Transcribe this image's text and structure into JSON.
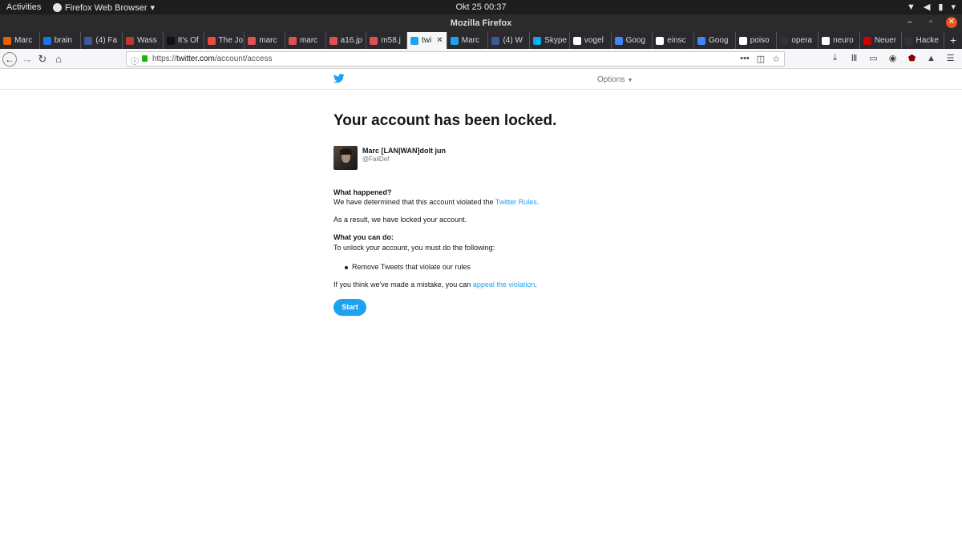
{
  "os_bar": {
    "activities": "Activities",
    "app_menu": "Firefox Web Browser",
    "clock": "Okt 25  00:37"
  },
  "window": {
    "title": "Mozilla Firefox"
  },
  "tabs": [
    {
      "label": "Marc",
      "favicon_color": "#e66000"
    },
    {
      "label": "brain",
      "favicon_color": "#1a73e8"
    },
    {
      "label": "(4) Fa",
      "favicon_color": "#3b5998"
    },
    {
      "label": "Wass",
      "favicon_color": "#c0392b"
    },
    {
      "label": "It's Of",
      "favicon_color": "#111111"
    },
    {
      "label": "The Jo",
      "favicon_color": "#e74c3c"
    },
    {
      "label": "marc",
      "favicon_color": "#e05050"
    },
    {
      "label": "marc",
      "favicon_color": "#e05050"
    },
    {
      "label": "a16.jp",
      "favicon_color": "#e05050"
    },
    {
      "label": "m58.j",
      "favicon_color": "#e05050"
    },
    {
      "label": "twi",
      "favicon_color": "#1da1f2",
      "active": true
    },
    {
      "label": "Marc",
      "favicon_color": "#1da1f2"
    },
    {
      "label": "(4) W",
      "favicon_color": "#3b5998"
    },
    {
      "label": "Skype",
      "favicon_color": "#00aff0"
    },
    {
      "label": "vogel",
      "favicon_color": "#ffffff"
    },
    {
      "label": "Goog",
      "favicon_color": "#4285f4"
    },
    {
      "label": "einsc",
      "favicon_color": "#ffffff"
    },
    {
      "label": "Goog",
      "favicon_color": "#4285f4"
    },
    {
      "label": "poiso",
      "favicon_color": "#ffffff"
    },
    {
      "label": "opera",
      "favicon_color": "#333333"
    },
    {
      "label": "neuro",
      "favicon_color": "#ffffff"
    },
    {
      "label": "Neuer",
      "favicon_color": "#cc0000"
    },
    {
      "label": "Hacke",
      "favicon_color": "#333333"
    }
  ],
  "navbar": {
    "url_scheme": "https://",
    "url_host": "twitter.com",
    "url_path": "/account/access"
  },
  "twitter": {
    "options_label": "Options",
    "headline": "Your account has been locked.",
    "account_name": "Marc [LAN|WAN]dolt jun",
    "account_handle": "@FailDef",
    "what_happened_heading": "What happened?",
    "what_happened_text": "We have determined that this account violated the ",
    "twitter_rules_link": "Twitter Rules",
    "period": ".",
    "result_text": "As a result, we have locked your account.",
    "what_you_can_do_heading": "What you can do:",
    "unlock_text": "To unlock your account, you must do the following:",
    "bullet_item": "Remove Tweets that violate our rules",
    "mistake_text": "If you think we've made a mistake, you can ",
    "appeal_link": "appeal the violation",
    "start_button": "Start"
  },
  "colors": {
    "twitter_blue": "#1da1f2",
    "text_primary": "#14171a",
    "text_secondary": "#657786"
  }
}
